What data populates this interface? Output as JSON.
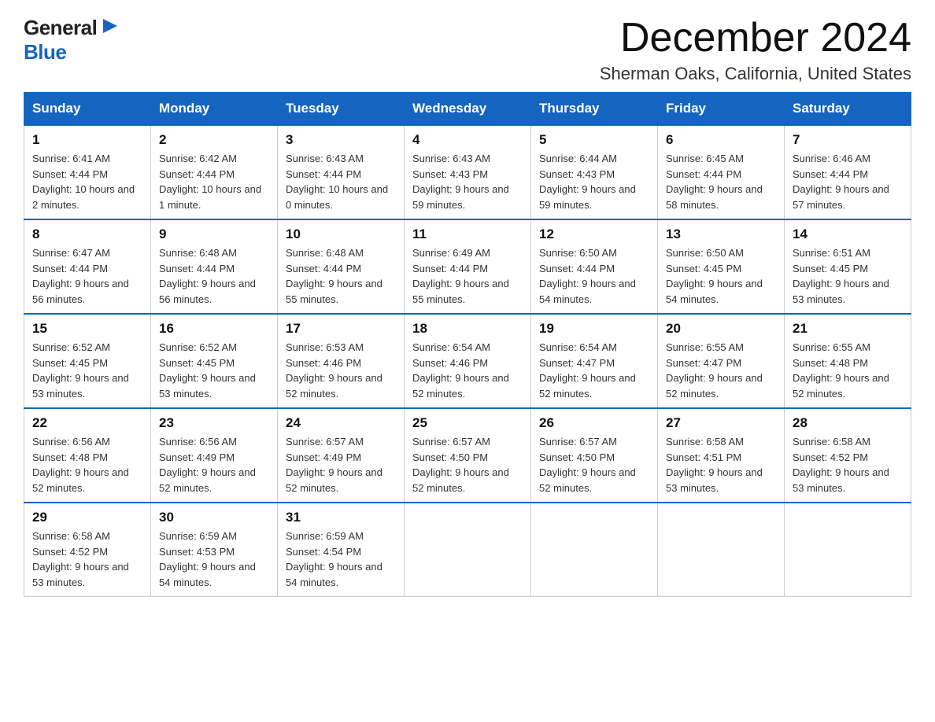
{
  "logo": {
    "general": "General",
    "blue": "Blue"
  },
  "title": "December 2024",
  "location": "Sherman Oaks, California, United States",
  "days_of_week": [
    "Sunday",
    "Monday",
    "Tuesday",
    "Wednesday",
    "Thursday",
    "Friday",
    "Saturday"
  ],
  "weeks": [
    [
      {
        "day": "1",
        "sunrise": "6:41 AM",
        "sunset": "4:44 PM",
        "daylight": "10 hours and 2 minutes."
      },
      {
        "day": "2",
        "sunrise": "6:42 AM",
        "sunset": "4:44 PM",
        "daylight": "10 hours and 1 minute."
      },
      {
        "day": "3",
        "sunrise": "6:43 AM",
        "sunset": "4:44 PM",
        "daylight": "10 hours and 0 minutes."
      },
      {
        "day": "4",
        "sunrise": "6:43 AM",
        "sunset": "4:43 PM",
        "daylight": "9 hours and 59 minutes."
      },
      {
        "day": "5",
        "sunrise": "6:44 AM",
        "sunset": "4:43 PM",
        "daylight": "9 hours and 59 minutes."
      },
      {
        "day": "6",
        "sunrise": "6:45 AM",
        "sunset": "4:44 PM",
        "daylight": "9 hours and 58 minutes."
      },
      {
        "day": "7",
        "sunrise": "6:46 AM",
        "sunset": "4:44 PM",
        "daylight": "9 hours and 57 minutes."
      }
    ],
    [
      {
        "day": "8",
        "sunrise": "6:47 AM",
        "sunset": "4:44 PM",
        "daylight": "9 hours and 56 minutes."
      },
      {
        "day": "9",
        "sunrise": "6:48 AM",
        "sunset": "4:44 PM",
        "daylight": "9 hours and 56 minutes."
      },
      {
        "day": "10",
        "sunrise": "6:48 AM",
        "sunset": "4:44 PM",
        "daylight": "9 hours and 55 minutes."
      },
      {
        "day": "11",
        "sunrise": "6:49 AM",
        "sunset": "4:44 PM",
        "daylight": "9 hours and 55 minutes."
      },
      {
        "day": "12",
        "sunrise": "6:50 AM",
        "sunset": "4:44 PM",
        "daylight": "9 hours and 54 minutes."
      },
      {
        "day": "13",
        "sunrise": "6:50 AM",
        "sunset": "4:45 PM",
        "daylight": "9 hours and 54 minutes."
      },
      {
        "day": "14",
        "sunrise": "6:51 AM",
        "sunset": "4:45 PM",
        "daylight": "9 hours and 53 minutes."
      }
    ],
    [
      {
        "day": "15",
        "sunrise": "6:52 AM",
        "sunset": "4:45 PM",
        "daylight": "9 hours and 53 minutes."
      },
      {
        "day": "16",
        "sunrise": "6:52 AM",
        "sunset": "4:45 PM",
        "daylight": "9 hours and 53 minutes."
      },
      {
        "day": "17",
        "sunrise": "6:53 AM",
        "sunset": "4:46 PM",
        "daylight": "9 hours and 52 minutes."
      },
      {
        "day": "18",
        "sunrise": "6:54 AM",
        "sunset": "4:46 PM",
        "daylight": "9 hours and 52 minutes."
      },
      {
        "day": "19",
        "sunrise": "6:54 AM",
        "sunset": "4:47 PM",
        "daylight": "9 hours and 52 minutes."
      },
      {
        "day": "20",
        "sunrise": "6:55 AM",
        "sunset": "4:47 PM",
        "daylight": "9 hours and 52 minutes."
      },
      {
        "day": "21",
        "sunrise": "6:55 AM",
        "sunset": "4:48 PM",
        "daylight": "9 hours and 52 minutes."
      }
    ],
    [
      {
        "day": "22",
        "sunrise": "6:56 AM",
        "sunset": "4:48 PM",
        "daylight": "9 hours and 52 minutes."
      },
      {
        "day": "23",
        "sunrise": "6:56 AM",
        "sunset": "4:49 PM",
        "daylight": "9 hours and 52 minutes."
      },
      {
        "day": "24",
        "sunrise": "6:57 AM",
        "sunset": "4:49 PM",
        "daylight": "9 hours and 52 minutes."
      },
      {
        "day": "25",
        "sunrise": "6:57 AM",
        "sunset": "4:50 PM",
        "daylight": "9 hours and 52 minutes."
      },
      {
        "day": "26",
        "sunrise": "6:57 AM",
        "sunset": "4:50 PM",
        "daylight": "9 hours and 52 minutes."
      },
      {
        "day": "27",
        "sunrise": "6:58 AM",
        "sunset": "4:51 PM",
        "daylight": "9 hours and 53 minutes."
      },
      {
        "day": "28",
        "sunrise": "6:58 AM",
        "sunset": "4:52 PM",
        "daylight": "9 hours and 53 minutes."
      }
    ],
    [
      {
        "day": "29",
        "sunrise": "6:58 AM",
        "sunset": "4:52 PM",
        "daylight": "9 hours and 53 minutes."
      },
      {
        "day": "30",
        "sunrise": "6:59 AM",
        "sunset": "4:53 PM",
        "daylight": "9 hours and 54 minutes."
      },
      {
        "day": "31",
        "sunrise": "6:59 AM",
        "sunset": "4:54 PM",
        "daylight": "9 hours and 54 minutes."
      },
      null,
      null,
      null,
      null
    ]
  ]
}
